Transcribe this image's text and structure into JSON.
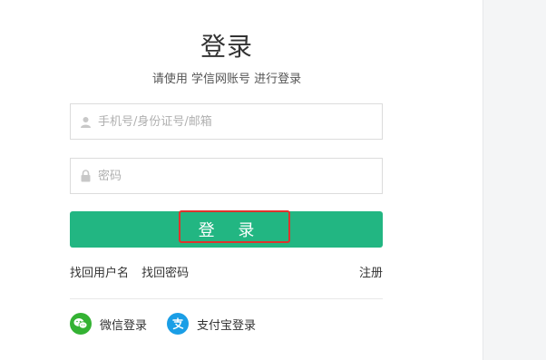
{
  "login": {
    "title": "登录",
    "subtitle": "请使用 学信网账号 进行登录",
    "account_placeholder": "手机号/身份证号/邮箱",
    "password_placeholder": "密码",
    "login_button": "登 录"
  },
  "links": {
    "find_username": "找回用户名",
    "find_password": "找回密码",
    "register": "注册"
  },
  "social": {
    "wechat_label": "微信登录",
    "alipay_label": "支付宝登录"
  },
  "colors": {
    "brand_green": "#22b682",
    "highlight_red": "#e0322c",
    "wechat_green": "#34b233",
    "alipay_blue": "#1a9ee6"
  },
  "icons": {
    "account": "user-icon",
    "password": "lock-icon",
    "wechat": "wechat-icon",
    "alipay": "alipay-icon"
  }
}
